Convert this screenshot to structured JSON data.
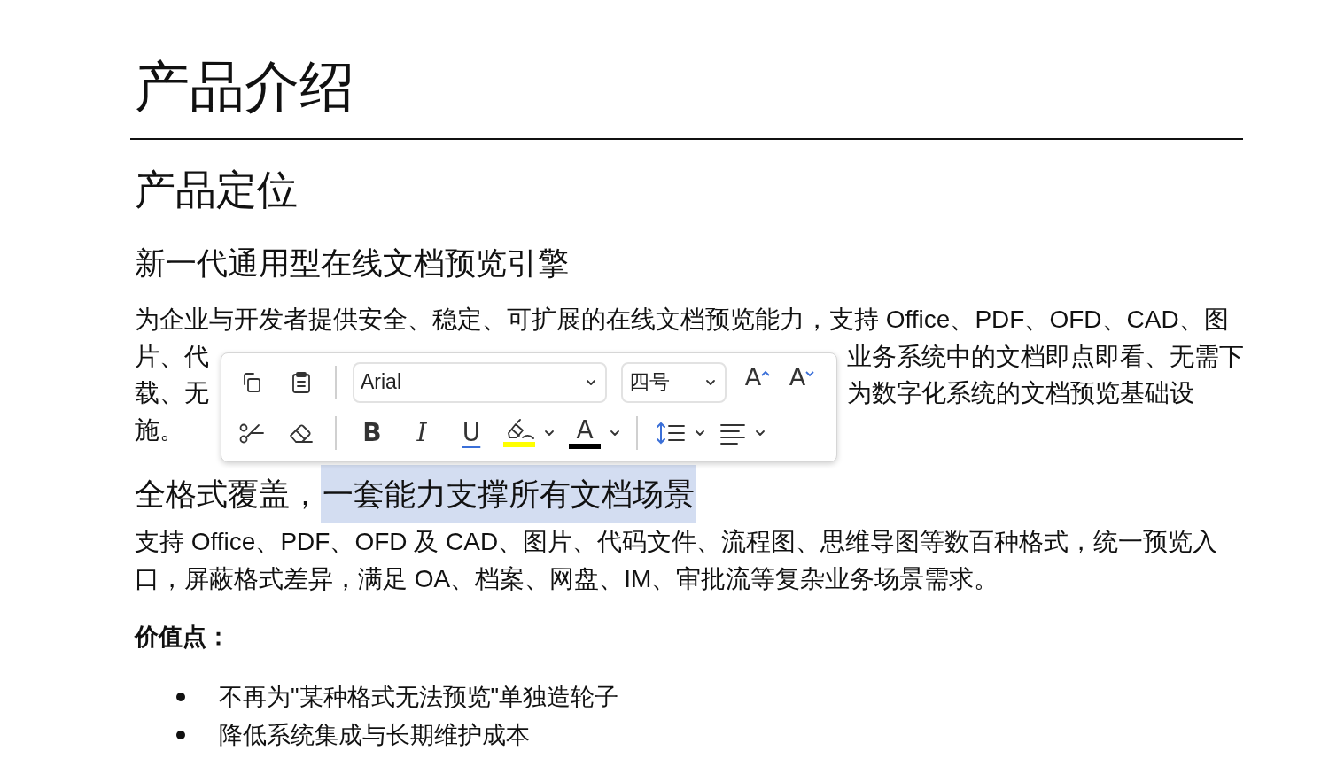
{
  "title": "产品介绍",
  "section_heading": "产品定位",
  "subheading": "新一代通用型在线文档预览引擎",
  "paragraph_lines": [
    {
      "left": "为企业与开发者提供安全、稳定、可扩展的在线文档预览能力，支持 Office、PDF、OFD、CAD、图"
    },
    {
      "left": "片、代",
      "right": "业务系统中的文档即点即看、无需下"
    },
    {
      "left": "载、无",
      "right": "为数字化系统的文档预览基础设"
    },
    {
      "left": "施。"
    }
  ],
  "heading_2": [
    {
      "text": "全格式覆盖，",
      "selected": false
    },
    {
      "text": "一套能力支撑所有文档场景",
      "selected": true
    }
  ],
  "paragraph_2": "支持 Office、PDF、OFD 及 CAD、图片、代码文件、流程图、思维导图等数百种格式，统一预览入口，屏蔽格式差异，满足 OA、档案、网盘、IM、审批流等复杂业务场景需求。",
  "value_label": "价值点：",
  "bullets": [
    "不再为\"某种格式无法预览\"单独造轮子",
    "降低系统集成与长期维护成本"
  ],
  "toolbar": {
    "rows": [
      [
        {
          "kind": "copy"
        },
        {
          "kind": "paste"
        },
        {
          "kind": "sep"
        },
        {
          "kind": "font-select",
          "value": "Arial"
        },
        {
          "kind": "size-select",
          "value": "四号"
        },
        {
          "kind": "grow-font",
          "label": "A"
        },
        {
          "kind": "shrink-font",
          "label": "A"
        }
      ],
      [
        {
          "kind": "cut"
        },
        {
          "kind": "clear-format"
        },
        {
          "kind": "sep"
        },
        {
          "kind": "bold",
          "label": "B"
        },
        {
          "kind": "italic",
          "label": "I"
        },
        {
          "kind": "underline",
          "label": "U"
        },
        {
          "kind": "highlight",
          "color": "#ffff00"
        },
        {
          "kind": "font-color",
          "label": "A",
          "color": "#000000"
        },
        {
          "kind": "sep"
        },
        {
          "kind": "line-spacing"
        },
        {
          "kind": "align"
        }
      ]
    ]
  }
}
